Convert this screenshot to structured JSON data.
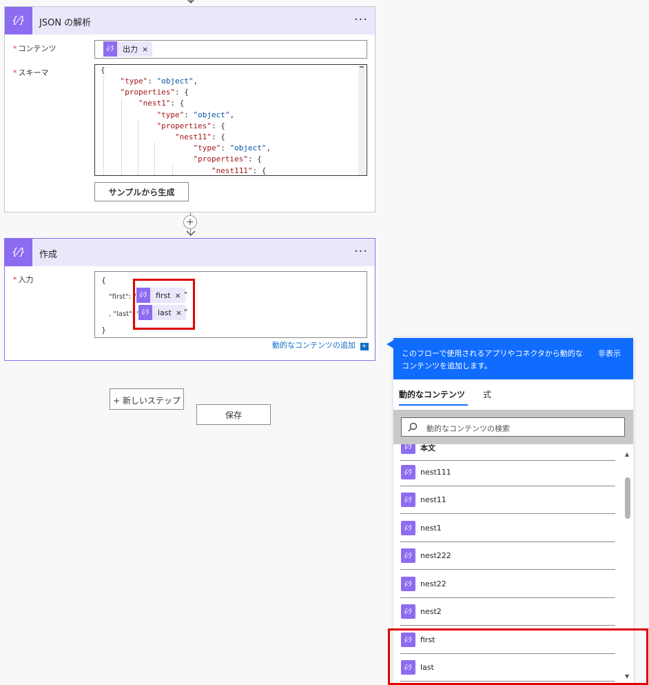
{
  "parse_json_card": {
    "title": "JSON の解析",
    "menu": "···",
    "content_label": "コンテンツ",
    "content_token": "出力",
    "schema_label": "スキーマ",
    "schema_lines": [
      [
        [
          "p",
          "{"
        ]
      ],
      [
        [
          "p",
          "    "
        ],
        [
          "k",
          "\"type\""
        ],
        [
          "p",
          ": "
        ],
        [
          "s",
          "\"object\""
        ],
        [
          "p",
          ","
        ]
      ],
      [
        [
          "p",
          "    "
        ],
        [
          "k",
          "\"properties\""
        ],
        [
          "p",
          ": {"
        ]
      ],
      [
        [
          "p",
          "        "
        ],
        [
          "k",
          "\"nest1\""
        ],
        [
          "p",
          ": {"
        ]
      ],
      [
        [
          "p",
          "            "
        ],
        [
          "k",
          "\"type\""
        ],
        [
          "p",
          ": "
        ],
        [
          "s",
          "\"object\""
        ],
        [
          "p",
          ","
        ]
      ],
      [
        [
          "p",
          "            "
        ],
        [
          "k",
          "\"properties\""
        ],
        [
          "p",
          ": {"
        ]
      ],
      [
        [
          "p",
          "                "
        ],
        [
          "k",
          "\"nest11\""
        ],
        [
          "p",
          ": {"
        ]
      ],
      [
        [
          "p",
          "                    "
        ],
        [
          "k",
          "\"type\""
        ],
        [
          "p",
          ": "
        ],
        [
          "s",
          "\"object\""
        ],
        [
          "p",
          ","
        ]
      ],
      [
        [
          "p",
          "                    "
        ],
        [
          "k",
          "\"properties\""
        ],
        [
          "p",
          ": {"
        ]
      ],
      [
        [
          "p",
          "                        "
        ],
        [
          "k",
          "\"nest111\""
        ],
        [
          "p",
          ": {"
        ]
      ]
    ],
    "generate_button": "サンプルから生成"
  },
  "connector_plus": "+",
  "compose_card": {
    "title": "作成",
    "menu": "···",
    "input_label": "入力",
    "open_brace": "{",
    "first_key": "\"first\": \"",
    "first_token": "first",
    "first_after": "\"",
    "last_key": ", \"last\": \"",
    "last_token": "last",
    "last_after": "\"",
    "close_brace": "}",
    "add_dynamic": "動的なコンテンツの追加"
  },
  "new_step_button": "+ 新しいステップ",
  "save_button": "保存",
  "dynamic_panel": {
    "description": "このフローで使用されるアプリやコネクタから動的なコンテンツを追加します。",
    "hide": "非表示",
    "tab_dynamic": "動的なコンテンツ",
    "tab_expression": "式",
    "search_placeholder": "動的なコンテンツの検索",
    "items": [
      "本文",
      "nest111",
      "nest11",
      "nest1",
      "nest222",
      "nest22",
      "nest2",
      "first",
      "last"
    ]
  },
  "token_icon_glyph": "{⁄}",
  "token_remove": "×"
}
